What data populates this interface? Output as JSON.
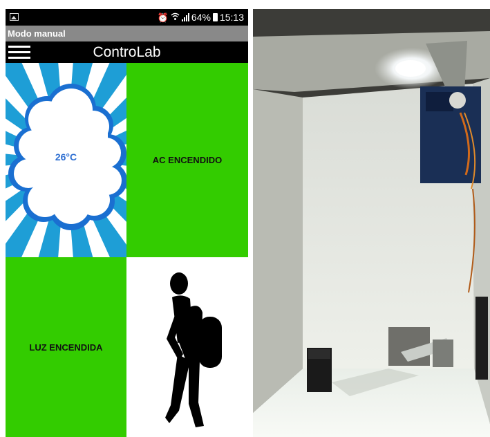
{
  "status_bar": {
    "battery": "64%",
    "time": "15:13",
    "icons": [
      "gallery-icon",
      "alarm-icon",
      "wifi-icon",
      "signal-icon",
      "battery-icon"
    ]
  },
  "window_title": "Modo manual",
  "app_bar": {
    "title": "ControLab",
    "menu_icon": "hamburger-menu-icon"
  },
  "tiles": {
    "temperature": {
      "value": "26°C",
      "icon": "cloud-icon"
    },
    "ac": {
      "label": "AC ENCENDIDO"
    },
    "light": {
      "label": "LUZ ENCENDIDA"
    },
    "presence": {
      "icon": "walking-person-icon"
    }
  },
  "colors": {
    "tile_green": "#33cc00",
    "sky_blue": "#1e9ed6",
    "temp_text": "#2e6fd2",
    "title_bar_gray": "#898989"
  }
}
